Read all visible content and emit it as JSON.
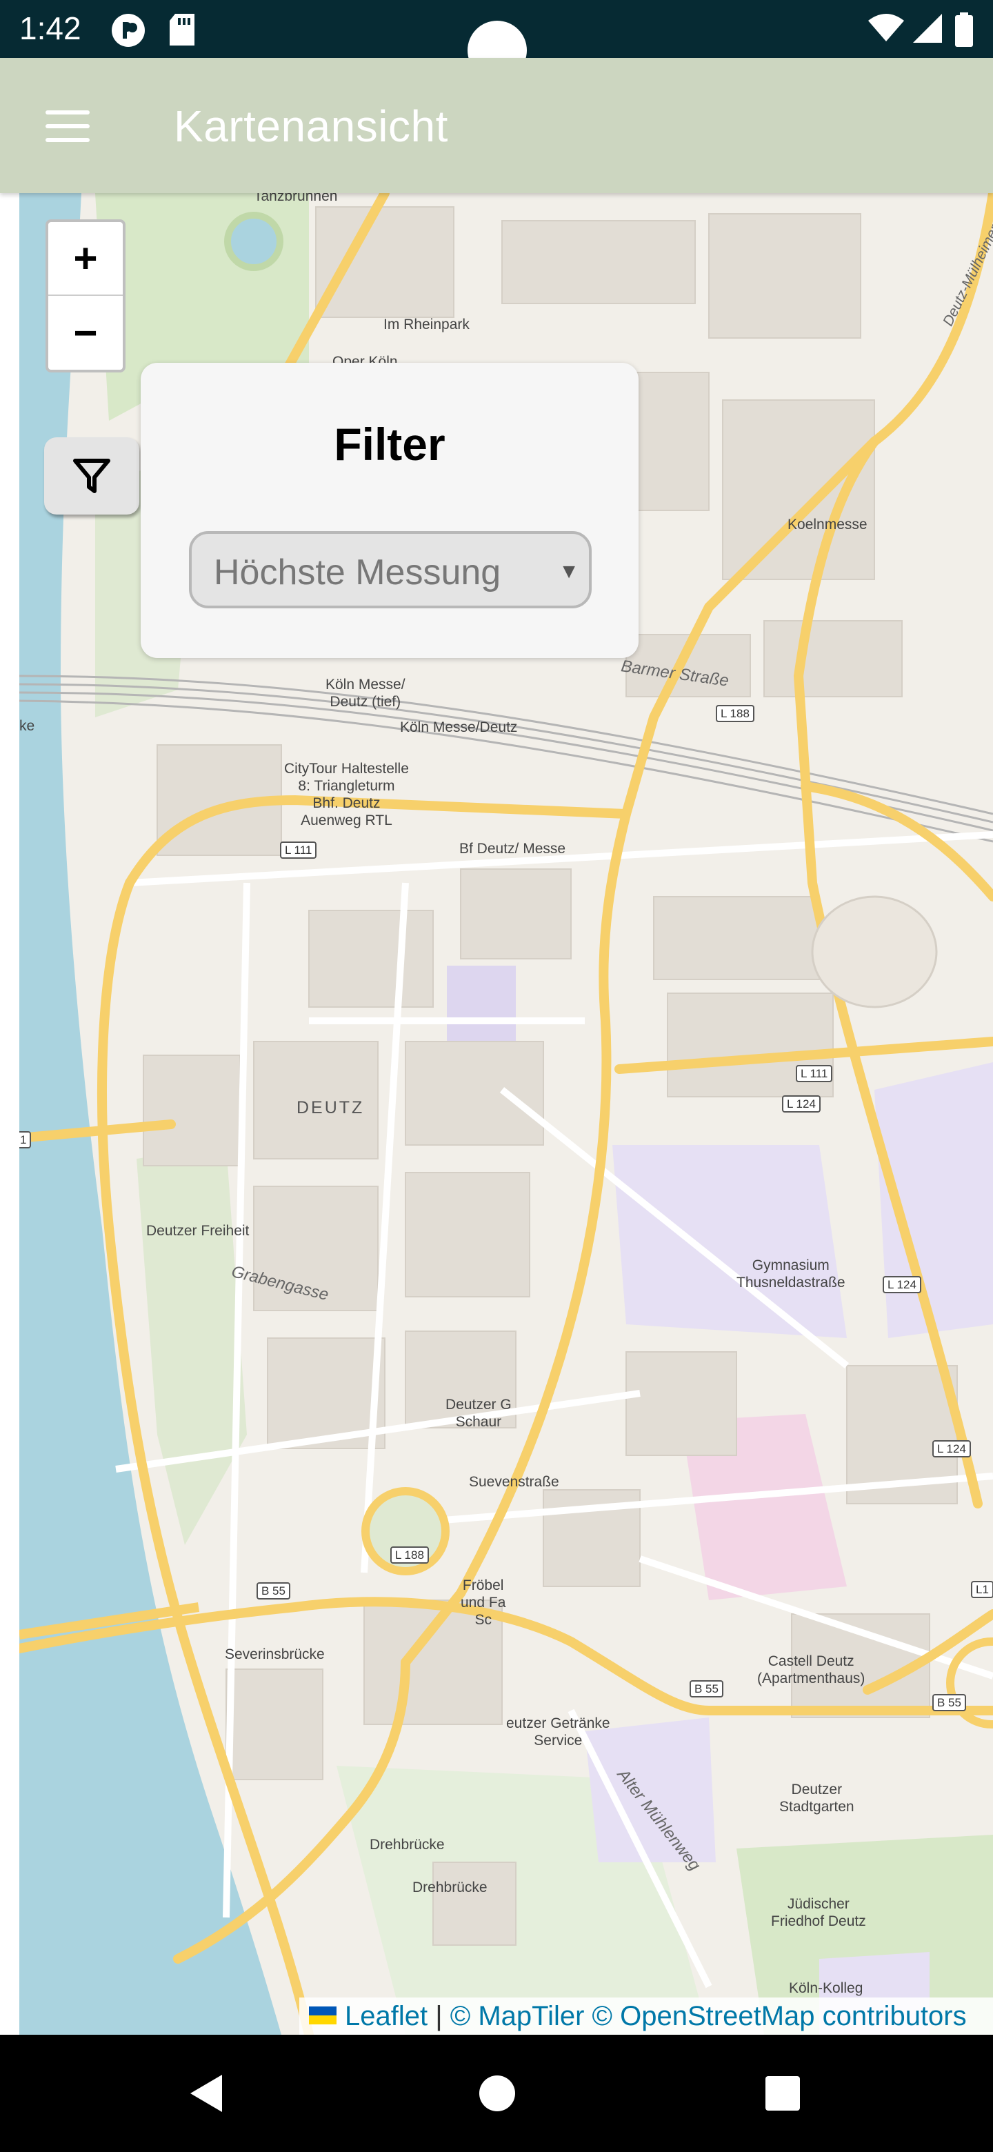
{
  "status_bar": {
    "time": "1:42",
    "icons": [
      "media-icon",
      "sd-card-icon",
      "wifi-icon",
      "signal-icon",
      "battery-icon"
    ]
  },
  "app_bar": {
    "title": "Kartenansicht",
    "menu_icon": "hamburger-menu-icon"
  },
  "map": {
    "zoom_in_label": "+",
    "zoom_out_label": "−",
    "filter_button_icon": "filter-funnel-icon",
    "labels": {
      "tanzbrunnen": "Tanzbrunnen",
      "im_rheinpark": "Im Rheinpark",
      "oper_koeln": "Oper Köln",
      "koelnmesse": "Koelnmesse",
      "barmer_strasse": "Barmer Straße",
      "koeln_messe_deutz_tief": "Köln Messe/\nDeutz (tief)",
      "koeln_messe_deutz": "Köln Messe/Deutz",
      "citytour": "CityTour Haltestelle\n8: Triangleturm\nBhf. Deutz\nAuenweg RTL",
      "bf_deutz_messe": "Bf Deutz/ Messe",
      "deutz": "DEUTZ",
      "deutzer_freiheit": "Deutzer Freiheit",
      "grabengasse": "Grabengasse",
      "gymnasium": "Gymnasium\nThusneldastraße",
      "deutzer_g": "Deutzer G\nSchaur",
      "suevenstrasse": "Suevenstraße",
      "froebel": "Fröbel\nund Fa\nSc",
      "severinsbruecke": "Severinsbrücke",
      "castell_deutz": "Castell Deutz\n(Apartmenthaus)",
      "getraenke": "eutzer Getränke\nService",
      "alter_muehlenweg": "Alter Mühlenweg",
      "deutzer_stadtgarten": "Deutzer\nStadtgarten",
      "drehbruecke_1": "Drehbrücke",
      "drehbruecke_2": "Drehbrücke",
      "juedischer_friedhof": "Jüdischer\nFriedhof Deutz",
      "koeln_kolleg": "Köln-Kolleg",
      "deutz_muelheimer": "Deutz-Mülheimer Str.",
      "ke": "ke"
    },
    "shields": {
      "l188_a": "L 188",
      "l111_a": "L 111",
      "l111_b": "L 111",
      "l124_a": "L 124",
      "l124_b": "L 124",
      "l124_c": "L 124",
      "l188_b": "L 188",
      "b55_a": "B 55",
      "b55_b": "B 55",
      "b55_c": "B 55",
      "l1_edge": "L1",
      "edge_1": "1"
    }
  },
  "filter_panel": {
    "title": "Filter",
    "select_value": "Höchste Messung",
    "select_arrow": "▼"
  },
  "attribution": {
    "leaflet": "Leaflet",
    "separator": " | ",
    "maptiler": "© MapTiler",
    "osm": "© OpenStreetMap contributors"
  },
  "nav_bar": {
    "back_icon": "back-triangle-icon",
    "home_icon": "home-circle-icon",
    "recents_icon": "recents-square-icon"
  },
  "colors": {
    "status_bar": "#062a33",
    "app_bar": "#ccd6c0",
    "map_background": "#f2efe9",
    "river": "#aad3df",
    "major_road": "#f7d06b",
    "link": "#0078a8"
  }
}
